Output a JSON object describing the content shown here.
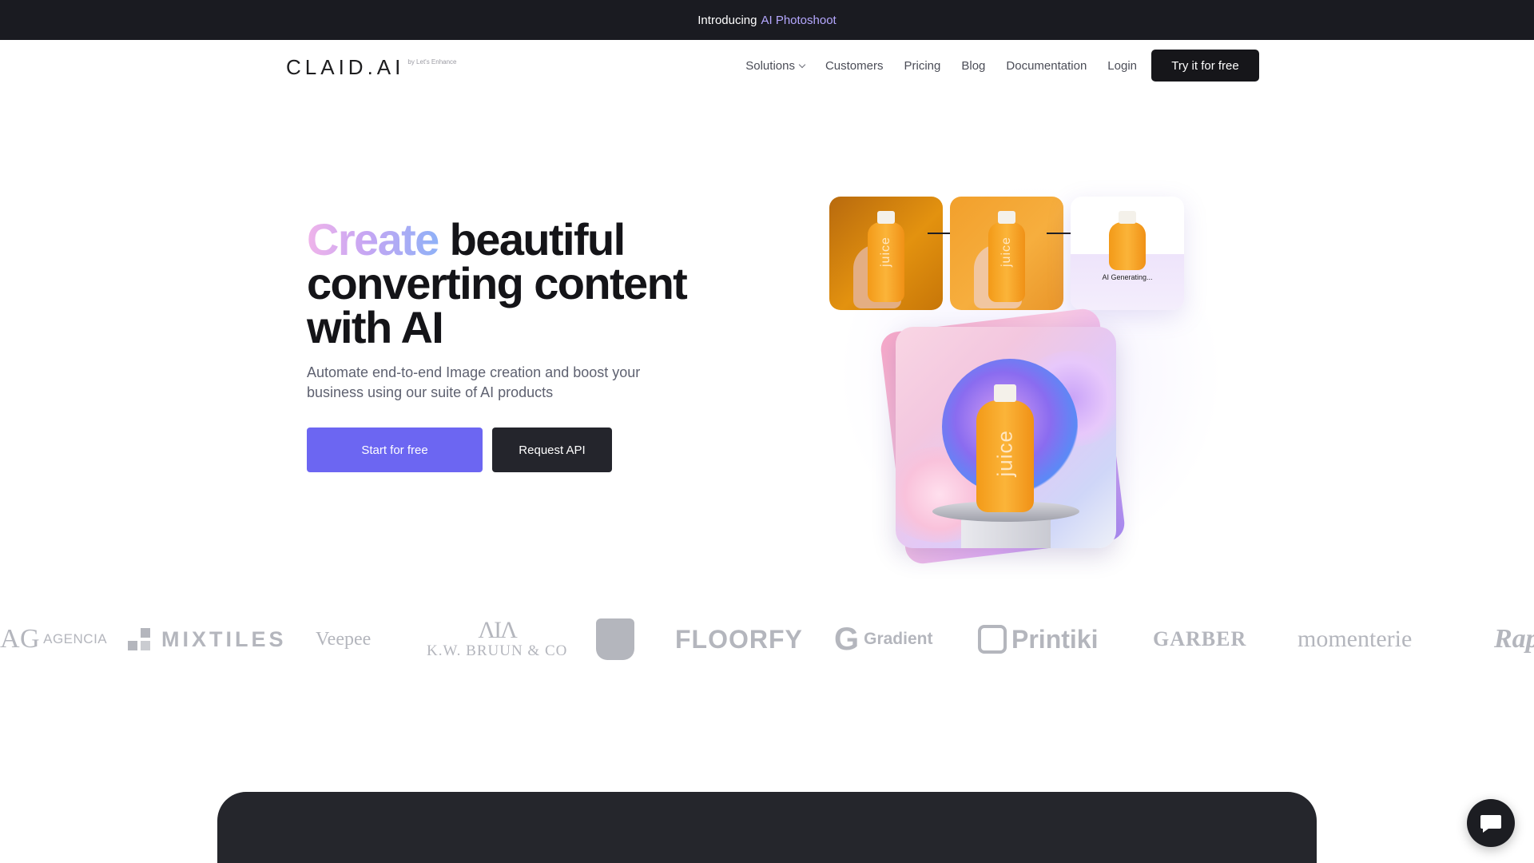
{
  "announcement": {
    "prefix": "Introducing",
    "highlight": "AI Photoshoot"
  },
  "nav": {
    "logo": "CLAID.AI",
    "logo_sub": "by Let's Enhance",
    "links": [
      {
        "label": "Solutions",
        "icon": "chevron-down-icon"
      },
      {
        "label": "Customers"
      },
      {
        "label": "Pricing"
      },
      {
        "label": "Blog"
      },
      {
        "label": "Documentation"
      },
      {
        "label": "Login"
      }
    ],
    "cta": "Try it for free"
  },
  "hero": {
    "title_highlight": "Create",
    "title_rest": " beautiful converting content with AI",
    "subtitle": "Automate end-to-end Image creation and boost your business using our suite of AI products",
    "primary_button": "Start for free",
    "secondary_button": "Request API",
    "generating_label": "AI Generating...",
    "bottle_label": "juice"
  },
  "logos": {
    "agencia_mark": "AG",
    "agencia": "AGENCIA",
    "mixtiles": "MIXTILES",
    "veepee": "Veepee",
    "bruun_mark": "ΛΙΛ",
    "bruun": "K.W. BRUUN & CO",
    "floorfy": "FLOORFY",
    "gradient_mark": "G",
    "gradient": "Gradient",
    "printiki": "Printiki",
    "garber": "GARBER",
    "momenterie": "momenterie",
    "rap": "Rap"
  },
  "colors": {
    "accent": "#6c66f2",
    "dark": "#16161a",
    "announcement_highlight": "#b5a8ff"
  }
}
